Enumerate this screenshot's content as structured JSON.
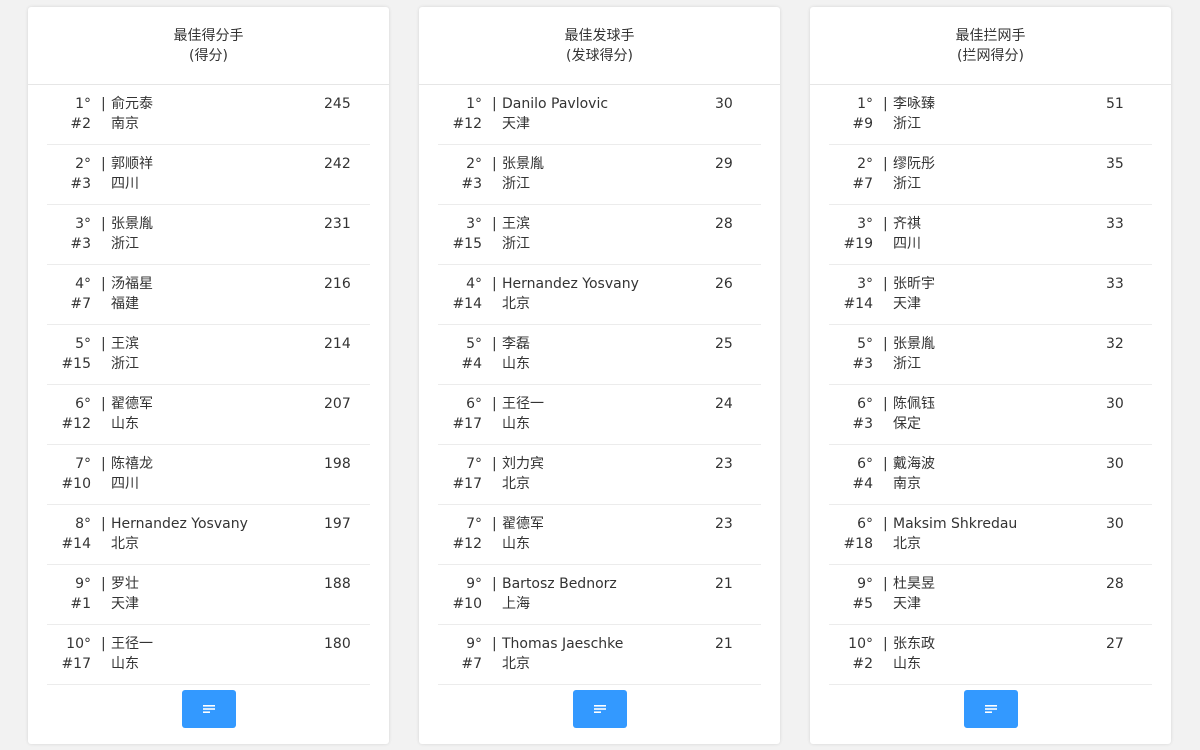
{
  "panels": [
    {
      "title": "最佳得分手",
      "subtitle": "(得分)",
      "rows": [
        {
          "rank": "1°",
          "number": "#2",
          "name": "俞元泰",
          "team": "南京",
          "value": "245"
        },
        {
          "rank": "2°",
          "number": "#3",
          "name": "郭顺祥",
          "team": "四川",
          "value": "242"
        },
        {
          "rank": "3°",
          "number": "#3",
          "name": "张景胤",
          "team": "浙江",
          "value": "231"
        },
        {
          "rank": "4°",
          "number": "#7",
          "name": "汤福星",
          "team": "福建",
          "value": "216"
        },
        {
          "rank": "5°",
          "number": "#15",
          "name": "王滨",
          "team": "浙江",
          "value": "214"
        },
        {
          "rank": "6°",
          "number": "#12",
          "name": "翟德军",
          "team": "山东",
          "value": "207"
        },
        {
          "rank": "7°",
          "number": "#10",
          "name": "陈禧龙",
          "team": "四川",
          "value": "198"
        },
        {
          "rank": "8°",
          "number": "#14",
          "name": "Hernandez Yosvany",
          "team": "北京",
          "value": "197"
        },
        {
          "rank": "9°",
          "number": "#1",
          "name": "罗壮",
          "team": "天津",
          "value": "188"
        },
        {
          "rank": "10°",
          "number": "#17",
          "name": "王径一",
          "team": "山东",
          "value": "180"
        }
      ]
    },
    {
      "title": "最佳发球手",
      "subtitle": "(发球得分)",
      "rows": [
        {
          "rank": "1°",
          "number": "#12",
          "name": "Danilo Pavlovic",
          "team": "天津",
          "value": "30"
        },
        {
          "rank": "2°",
          "number": "#3",
          "name": "张景胤",
          "team": "浙江",
          "value": "29"
        },
        {
          "rank": "3°",
          "number": "#15",
          "name": "王滨",
          "team": "浙江",
          "value": "28"
        },
        {
          "rank": "4°",
          "number": "#14",
          "name": "Hernandez Yosvany",
          "team": "北京",
          "value": "26"
        },
        {
          "rank": "5°",
          "number": "#4",
          "name": "李磊",
          "team": "山东",
          "value": "25"
        },
        {
          "rank": "6°",
          "number": "#17",
          "name": "王径一",
          "team": "山东",
          "value": "24"
        },
        {
          "rank": "7°",
          "number": "#17",
          "name": "刘力宾",
          "team": "北京",
          "value": "23"
        },
        {
          "rank": "7°",
          "number": "#12",
          "name": "翟德军",
          "team": "山东",
          "value": "23"
        },
        {
          "rank": "9°",
          "number": "#10",
          "name": "Bartosz Bednorz",
          "team": "上海",
          "value": "21"
        },
        {
          "rank": "9°",
          "number": "#7",
          "name": "Thomas Jaeschke",
          "team": "北京",
          "value": "21"
        }
      ]
    },
    {
      "title": "最佳拦网手",
      "subtitle": "(拦网得分)",
      "rows": [
        {
          "rank": "1°",
          "number": "#9",
          "name": "李咏臻",
          "team": "浙江",
          "value": "51"
        },
        {
          "rank": "2°",
          "number": "#7",
          "name": "缪阮彤",
          "team": "浙江",
          "value": "35"
        },
        {
          "rank": "3°",
          "number": "#19",
          "name": "齐祺",
          "team": "四川",
          "value": "33"
        },
        {
          "rank": "3°",
          "number": "#14",
          "name": "张昕宇",
          "team": "天津",
          "value": "33"
        },
        {
          "rank": "5°",
          "number": "#3",
          "name": "张景胤",
          "team": "浙江",
          "value": "32"
        },
        {
          "rank": "6°",
          "number": "#3",
          "name": "陈佩钰",
          "team": "保定",
          "value": "30"
        },
        {
          "rank": "6°",
          "number": "#4",
          "name": "戴海波",
          "team": "南京",
          "value": "30"
        },
        {
          "rank": "6°",
          "number": "#18",
          "name": "Maksim Shkredau",
          "team": "北京",
          "value": "30"
        },
        {
          "rank": "9°",
          "number": "#5",
          "name": "杜昊昱",
          "team": "天津",
          "value": "28"
        },
        {
          "rank": "10°",
          "number": "#2",
          "name": "张东政",
          "team": "山东",
          "value": "27"
        }
      ]
    }
  ],
  "separator": "|",
  "button_icon": "menu-icon",
  "colors": {
    "accent": "#3399ff",
    "background": "#f2f2f2",
    "card": "#ffffff",
    "text": "#333333"
  }
}
